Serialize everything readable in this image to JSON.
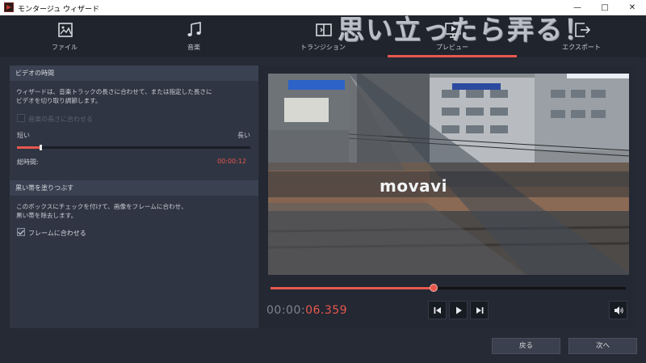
{
  "window": {
    "title": "モンタージュ ウィザード",
    "minimize": "—",
    "maximize": "□",
    "close": "✕"
  },
  "overlay_text": "思い立ったら弄る！",
  "tabs": [
    {
      "label": "ファイル",
      "icon": "file-icon"
    },
    {
      "label": "音楽",
      "icon": "music-icon"
    },
    {
      "label": "トランジション",
      "icon": "transition-icon"
    },
    {
      "label": "プレビュー",
      "icon": "preview-icon",
      "active": true
    },
    {
      "label": "エクスポート",
      "icon": "export-icon"
    }
  ],
  "video_duration": {
    "heading": "ビデオの時間",
    "description_line1": "ウィザードは、音楽トラックの長さに合わせて、または指定した長さに",
    "description_line2": "ビデオを切り取り調節します。",
    "match_music_label": "音楽の長さに合わせる",
    "match_music_checked": false,
    "short_label": "短い",
    "long_label": "長い",
    "slider_fraction": 0.1,
    "total_label": "総時間:",
    "total_value": "00:00:12"
  },
  "black_bars": {
    "heading": "黒い帯を塗りつぶす",
    "description_line1": "このボックスにチェックを付けて、画像をフレームに合わせ、",
    "description_line2": "黒い帯を除去します。",
    "fit_frame_label": "フレームに合わせる",
    "fit_frame_checked": true
  },
  "preview": {
    "watermark": "movavi",
    "progress_fraction": 0.46,
    "time_prefix": "00:00:",
    "time_suffix": "06.359"
  },
  "colors": {
    "accent": "#e8574c"
  },
  "footer": {
    "back_label": "戻る",
    "next_label": "次へ"
  }
}
